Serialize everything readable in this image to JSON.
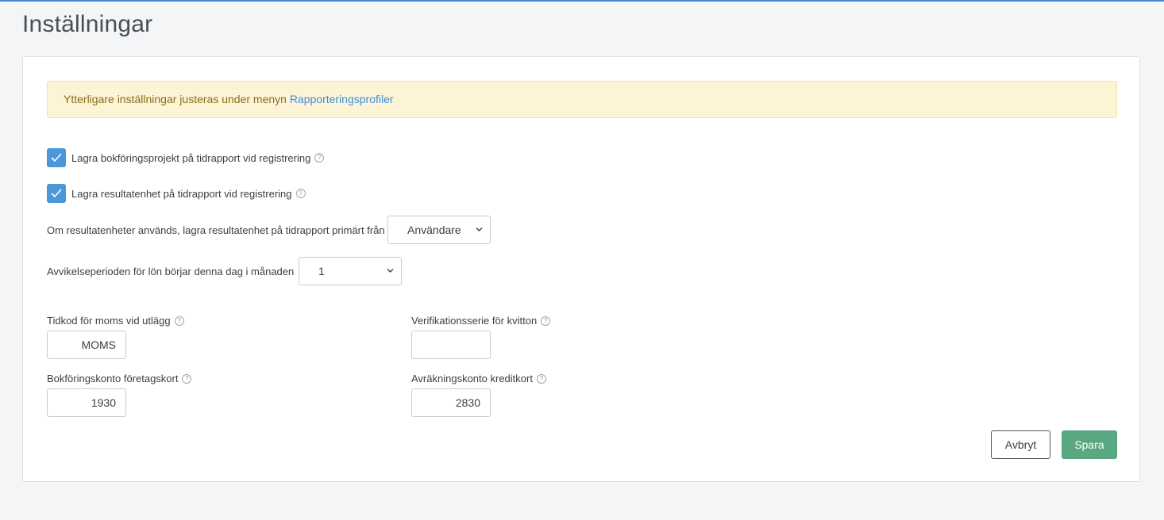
{
  "page": {
    "title": "Inställningar"
  },
  "notice": {
    "text": "Ytterligare inställningar justeras under menyn ",
    "link": "Rapporteringsprofiler"
  },
  "settings": {
    "checkbox_project": {
      "label": "Lagra bokföringsprojekt på tidrapport vid registrering",
      "checked": true
    },
    "checkbox_result_unit": {
      "label": "Lagra resultatenhet på tidrapport vid registrering",
      "checked": true
    },
    "result_unit_source": {
      "label": "Om resultatenheter används, lagra resultatenhet på tidrapport primärt från",
      "value": "Användare"
    },
    "deviation_period": {
      "label": "Avvikelseperioden för lön börjar denna dag i månaden",
      "value": "1"
    }
  },
  "fields": {
    "vat_time_code": {
      "label": "Tidkod för moms vid utlägg",
      "value": "MOMS"
    },
    "receipt_series": {
      "label": "Verifikationsserie för kvitton",
      "value": ""
    },
    "company_card_account": {
      "label": "Bokföringskonto företagskort",
      "value": "1930"
    },
    "credit_card_clearing": {
      "label": "Avräkningskonto kreditkort",
      "value": "2830"
    }
  },
  "actions": {
    "cancel_label": "Avbryt",
    "save_label": "Spara"
  },
  "colors": {
    "accent": "#3e8fd8",
    "checkbox": "#4a98d9",
    "save": "#5aa882",
    "notice_bg": "#fcf4d5"
  },
  "icons": {
    "help": "question-circle-icon",
    "chevron": "chevron-down-icon",
    "check": "check-icon"
  }
}
